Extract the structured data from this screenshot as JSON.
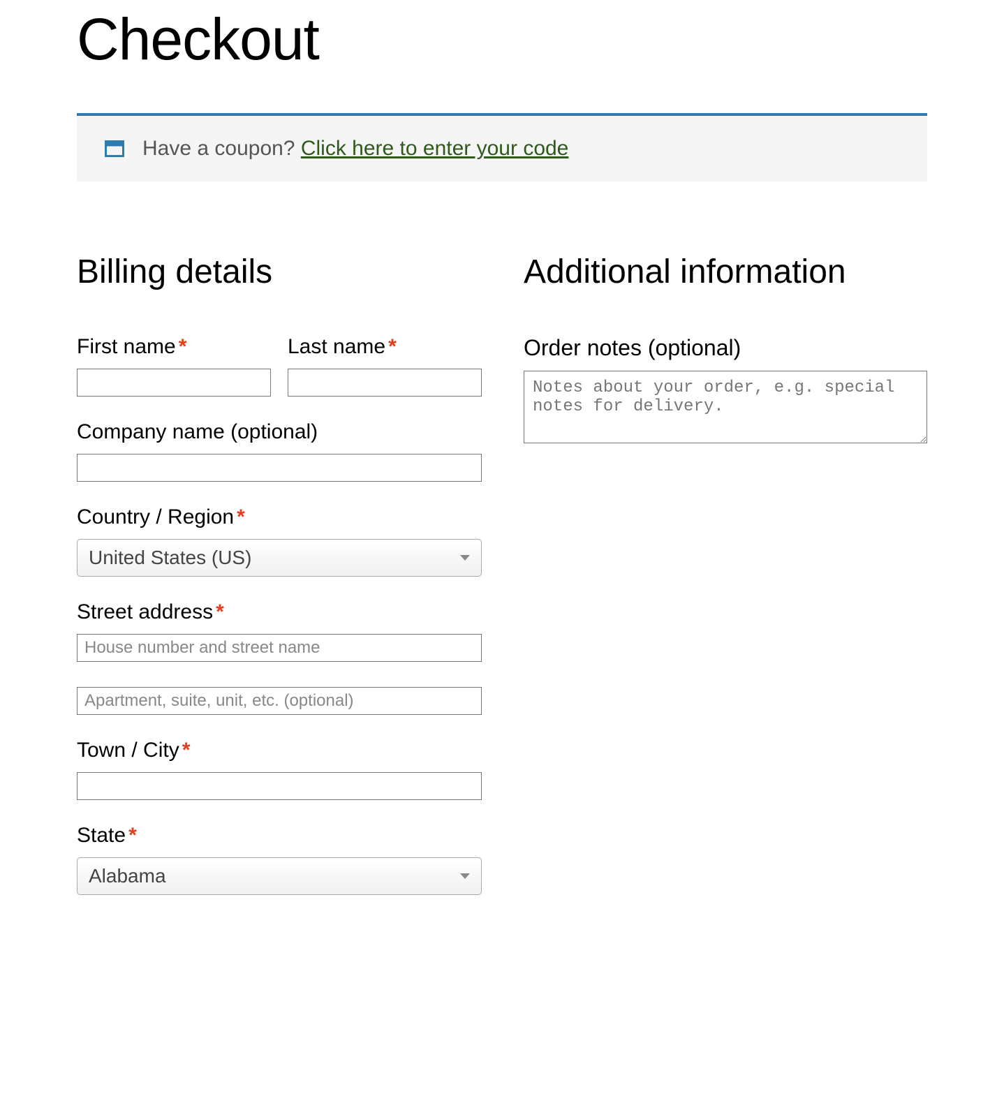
{
  "page": {
    "title": "Checkout"
  },
  "coupon": {
    "prompt": "Have a coupon? ",
    "link_text": "Click here to enter your code"
  },
  "billing": {
    "heading": "Billing details",
    "first_name_label": "First name",
    "last_name_label": "Last name",
    "company_label": "Company name (optional)",
    "country_label": "Country / Region",
    "country_value": "United States (US)",
    "street_label": "Street address",
    "street1_placeholder": "House number and street name",
    "street2_placeholder": "Apartment, suite, unit, etc. (optional)",
    "city_label": "Town / City",
    "state_label": "State",
    "state_value": "Alabama",
    "required_marker": "*"
  },
  "additional": {
    "heading": "Additional information",
    "order_notes_label": "Order notes (optional)",
    "order_notes_placeholder": "Notes about your order, e.g. special notes for delivery."
  }
}
